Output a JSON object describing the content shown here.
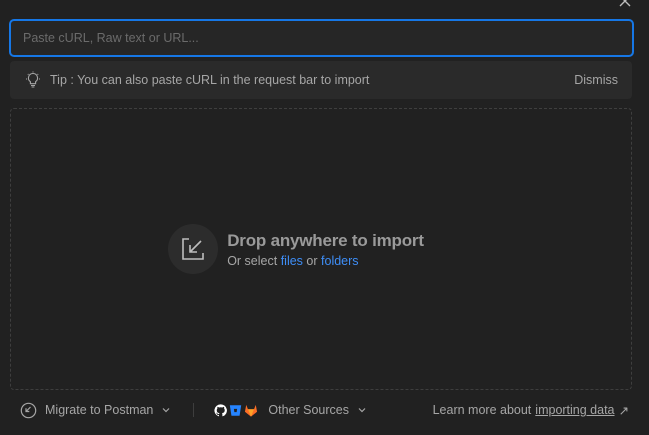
{
  "search": {
    "placeholder": "Paste cURL, Raw text or URL...",
    "value": ""
  },
  "tip": {
    "text": "Tip : You can also paste cURL in the request bar to import",
    "dismiss_label": "Dismiss",
    "icon": "lightbulb-icon"
  },
  "dropzone": {
    "title": "Drop anywhere to import",
    "prefix": "Or select",
    "files_label": "files",
    "connector": "or",
    "folders_label": "folders",
    "icon": "import-arrow-icon"
  },
  "footer": {
    "migrate_label": "Migrate to Postman",
    "other_sources_label": "Other Sources",
    "learn_prefix": "Learn more about",
    "learn_link": "importing data",
    "learn_arrow": "↗"
  },
  "colors": {
    "accent": "#1677e6",
    "link": "#3e8ef7",
    "background": "#212121",
    "github": "#ffffff",
    "bitbucket": "#2684ff",
    "gitlab": "#fc6d26"
  }
}
